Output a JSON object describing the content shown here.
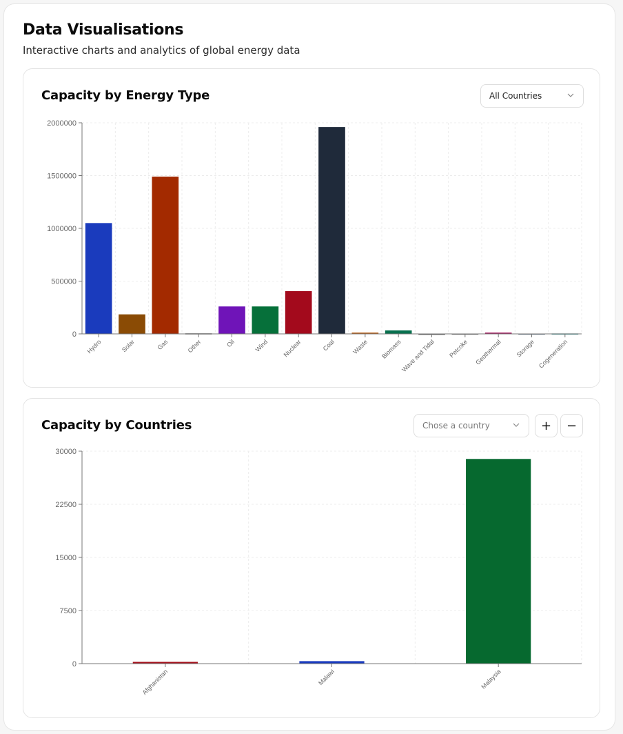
{
  "header": {
    "title": "Data Visualisations",
    "subtitle": "Interactive charts and analytics of global energy data"
  },
  "energy_card": {
    "title": "Capacity by Energy Type",
    "filter_value": "All Countries"
  },
  "countries_card": {
    "title": "Capacity by Countries",
    "country_placeholder": "Chose a country",
    "add_label": "+",
    "remove_label": "−"
  },
  "chart_data": [
    {
      "type": "bar",
      "title": "Capacity by Energy Type",
      "categories": [
        "Hydro",
        "Solar",
        "Gas",
        "Other",
        "Oil",
        "Wind",
        "Nuclear",
        "Coal",
        "Waste",
        "Biomass",
        "Wave and Tidal",
        "Petcoke",
        "Geothermal",
        "Storage",
        "Cogeneration"
      ],
      "values": [
        1050000,
        185000,
        1490000,
        5000,
        260000,
        260000,
        405000,
        1960000,
        12000,
        33000,
        1000,
        3000,
        12000,
        3000,
        4000
      ],
      "colors": [
        "#1a3bbd",
        "#8a4b05",
        "#a32a00",
        "#4a4a4a",
        "#6f14b8",
        "#06703a",
        "#a30a1c",
        "#1f2a3a",
        "#b4560a",
        "#07704e",
        "#555555",
        "#5a5a5a",
        "#a0105a",
        "#5b6b7d",
        "#1a7a7a"
      ],
      "yticks": [
        0,
        500000,
        1000000,
        1500000,
        2000000
      ],
      "ylim": [
        0,
        2000000
      ],
      "grid": true
    },
    {
      "type": "bar",
      "title": "Capacity by Countries",
      "categories": [
        "Afghanistan",
        "Malawi",
        "Malaysia"
      ],
      "values": [
        250,
        350,
        28900
      ],
      "colors": [
        "#a3101c",
        "#1a3bbd",
        "#06692f"
      ],
      "yticks": [
        0,
        7500,
        15000,
        22500,
        30000
      ],
      "ylim": [
        0,
        30000
      ],
      "grid": true
    }
  ]
}
